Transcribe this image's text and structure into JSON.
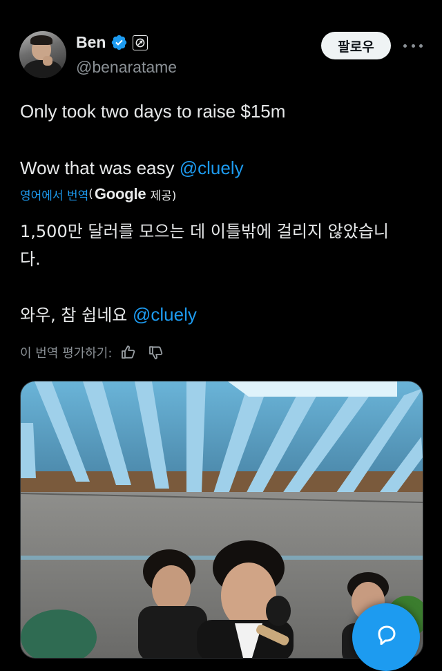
{
  "header": {
    "display_name": "Ben",
    "handle": "@benaratame",
    "follow_label": "팔로우"
  },
  "tweet": {
    "line1": "Only took two days to raise $15m",
    "line2_prefix": "Wow that was easy ",
    "mention": "@cluely"
  },
  "translation": {
    "translate_label": "영어에서 번역",
    "open_paren": "(",
    "google": "Google",
    "provided": " 제공)",
    "line1": "1,500만 달러를 모으는 데 이틀밖에 걸리지 않았습니",
    "line2": "다.",
    "line3_prefix": "와우, 참 쉽네요 ",
    "mention": "@cluely",
    "rate_label": "이 번역 평가하기:"
  },
  "colors": {
    "background": "#000000",
    "text": "#e7e9ea",
    "secondary": "#8b9196",
    "accent": "#1d9bf0"
  },
  "icons": [
    "verified-badge-icon",
    "affiliate-badge-icon",
    "more-icon",
    "thumbs-up-icon",
    "thumbs-down-icon",
    "reply-icon"
  ]
}
